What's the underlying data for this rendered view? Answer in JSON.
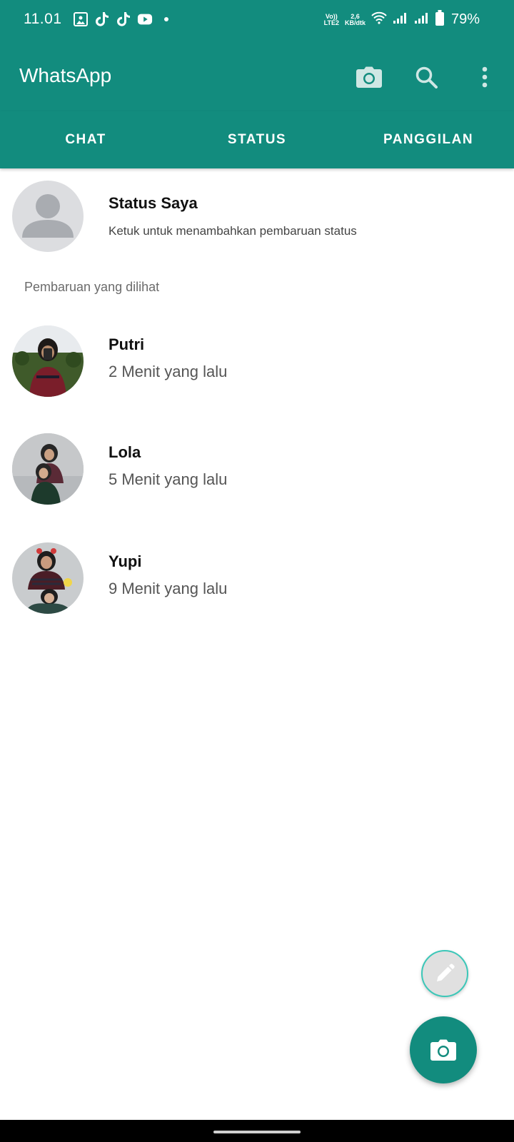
{
  "status_bar": {
    "time": "11.01",
    "apps": [
      "gallery-icon",
      "tiktok-icon",
      "tiktok-icon",
      "youtube-icon",
      "dot-icon"
    ],
    "volte_top": "Vo))",
    "volte_bottom": "LTE2",
    "speed_top": "2,6",
    "speed_bottom": "KB/dtk",
    "battery": "79%"
  },
  "appbar": {
    "title": "WhatsApp"
  },
  "tabs": [
    {
      "label": "CHAT",
      "active": false
    },
    {
      "label": "STATUS",
      "active": true
    },
    {
      "label": "PANGGILAN",
      "active": false
    }
  ],
  "my_status": {
    "name": "Status Saya",
    "subtitle": "Ketuk untuk menambahkan pembaruan status"
  },
  "section_label": "Pembaruan yang dilihat",
  "updates": [
    {
      "name": "Putri",
      "time": "2 Menit yang lalu"
    },
    {
      "name": "Lola",
      "time": "5 Menit yang lalu"
    },
    {
      "name": "Yupi",
      "time": "9 Menit yang lalu"
    }
  ],
  "colors": {
    "brand": "#128C7E",
    "fab_border": "#3cc7b8"
  }
}
